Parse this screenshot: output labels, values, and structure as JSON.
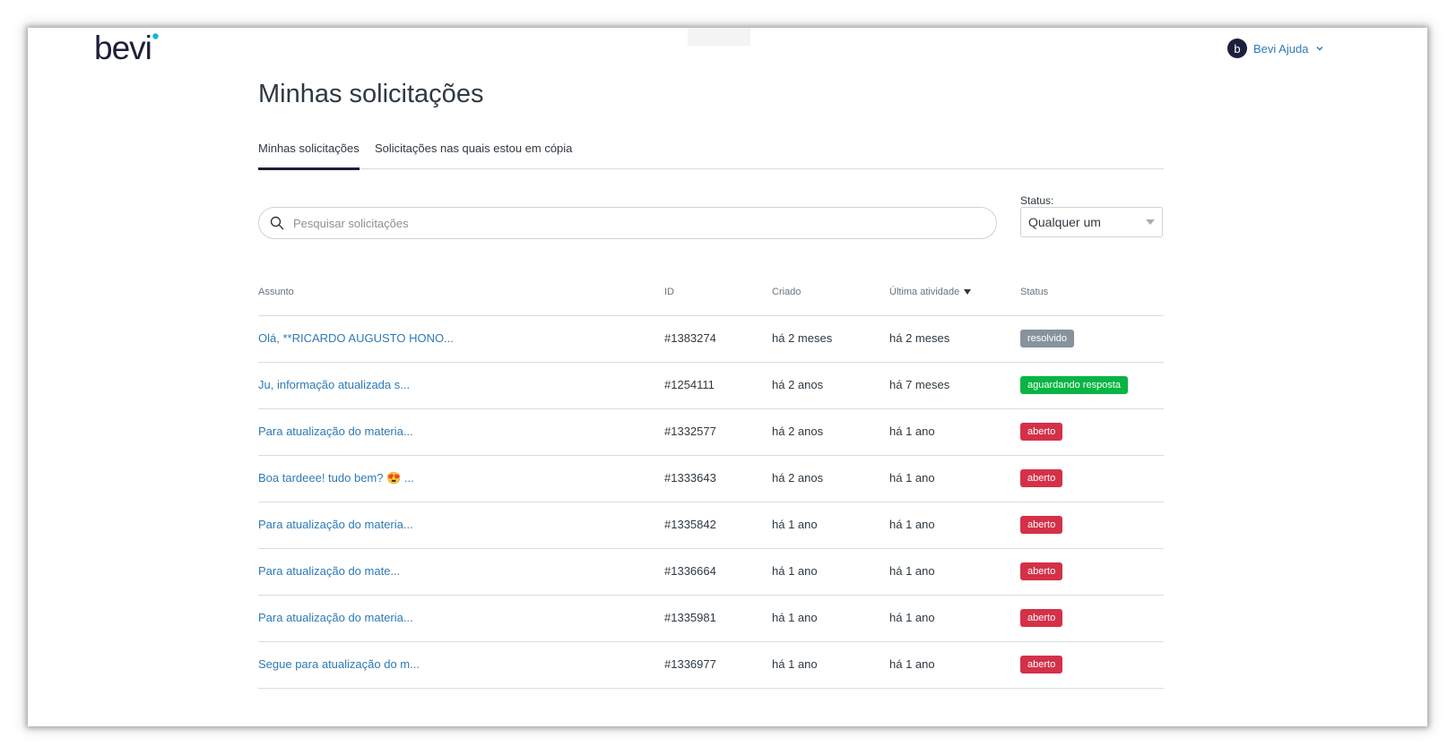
{
  "header": {
    "logo_text": "bevi",
    "user": {
      "initial": "b",
      "name": "Bevi Ajuda"
    }
  },
  "page": {
    "title": "Minhas solicitações"
  },
  "tabs": [
    {
      "label": "Minhas solicitações",
      "active": true
    },
    {
      "label": "Solicitações nas quais estou em cópia",
      "active": false
    }
  ],
  "search": {
    "placeholder": "Pesquisar solicitações",
    "value": ""
  },
  "status_filter": {
    "label": "Status:",
    "selected": "Qualquer um"
  },
  "table": {
    "columns": {
      "subject": "Assunto",
      "id": "ID",
      "created": "Criado",
      "last_activity": "Última atividade",
      "status": "Status"
    },
    "rows": [
      {
        "subject": "Olá, **RICARDO AUGUSTO HONO...",
        "id": "#1383274",
        "created": "há 2 meses",
        "last_activity": "há 2 meses",
        "status": "resolvido",
        "status_color": "#87929d"
      },
      {
        "subject": "Ju, informação atualizada s...",
        "id": "#1254111",
        "created": "há 2 anos",
        "last_activity": "há 7 meses",
        "status": "aguardando resposta",
        "status_color": "#07b543"
      },
      {
        "subject": "Para atualização do materia...",
        "id": "#1332577",
        "created": "há 2 anos",
        "last_activity": "há 1 ano",
        "status": "aberto",
        "status_color": "#d43149"
      },
      {
        "subject": "Boa tardeee! tudo bem? 😍 ...",
        "id": "#1333643",
        "created": "há 2 anos",
        "last_activity": "há 1 ano",
        "status": "aberto",
        "status_color": "#d43149"
      },
      {
        "subject": "Para atualização do materia...",
        "id": "#1335842",
        "created": "há 1 ano",
        "last_activity": "há 1 ano",
        "status": "aberto",
        "status_color": "#d43149"
      },
      {
        "subject": " Para atualização do mate...",
        "id": "#1336664",
        "created": "há 1 ano",
        "last_activity": "há 1 ano",
        "status": "aberto",
        "status_color": "#d43149"
      },
      {
        "subject": "Para atualização do materia...",
        "id": "#1335981",
        "created": "há 1 ano",
        "last_activity": "há 1 ano",
        "status": "aberto",
        "status_color": "#d43149"
      },
      {
        "subject": "Segue para atualização do m...",
        "id": "#1336977",
        "created": "há 1 ano",
        "last_activity": "há 1 ano",
        "status": "aberto",
        "status_color": "#d43149"
      }
    ]
  },
  "colors": {
    "brand_navy": "#1b1f3b",
    "brand_cyan": "#17b3d6",
    "link_blue": "#2d7ab8"
  }
}
